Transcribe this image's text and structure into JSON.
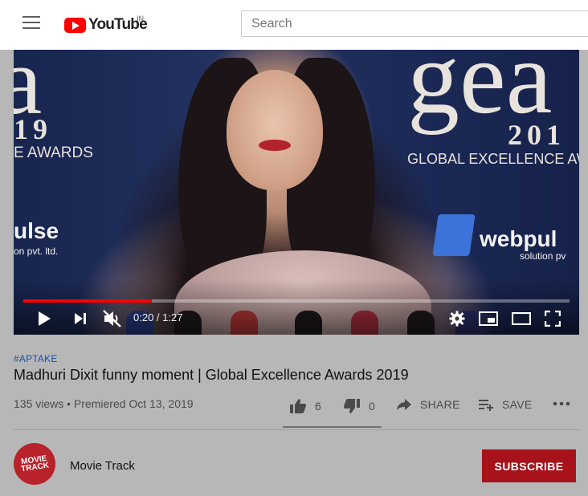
{
  "header": {
    "logo_text": "YouTube",
    "country_code": "IN",
    "search_placeholder": "Search"
  },
  "player": {
    "progress_fraction": 0.236,
    "time_label": "0:20 / 1:27",
    "background_text": {
      "left_year": "19",
      "left_awards": "E AWARDS",
      "right_year": "201",
      "right_awards": "GLOBAL EXCELLENCE AW",
      "left_brand": "ulse",
      "left_brand_sub": "on pvt. ltd.",
      "right_brand": "webpul",
      "right_brand_sub": "solution pv"
    }
  },
  "video": {
    "tag": "#APTAKE",
    "title": "Madhuri Dixit funny moment | Global Excellence Awards 2019",
    "meta": "135 views • Premiered Oct 13, 2019",
    "likes": "6",
    "dislikes": "0",
    "share_label": "SHARE",
    "save_label": "SAVE"
  },
  "channel": {
    "name": "Movie Track",
    "avatar_text": "MOVIE TRACK",
    "subscribe_label": "SUBSCRIBE"
  },
  "colors": {
    "brand_red": "#ff0000",
    "subscribe_bg": "#a8121a",
    "tag_blue": "#1a4fa3"
  }
}
